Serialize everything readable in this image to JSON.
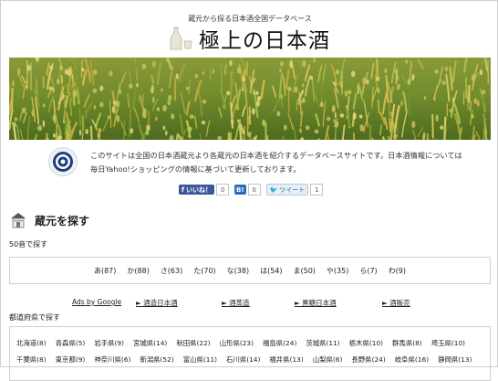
{
  "header": {
    "tagline": "蔵元から探る日本酒全国データベース",
    "title": "極上の日本酒"
  },
  "intro": {
    "line1": "このサイトは全国の日本酒蔵元より各蔵元の日本酒を紹介するデータベースサイトです。日本酒情報については",
    "line2": "毎日Yahoo!ショッピングの情報に基づいて更新しております。"
  },
  "social": {
    "like_label": "いいね！",
    "like_count": "0",
    "hatena_label": "B!",
    "hatena_count": "0",
    "tweet_label": "ツイート",
    "tweet_count": "1"
  },
  "section": {
    "title": "蔵元を探す",
    "kana_label": "50音で探す",
    "pref_label": "都道府県で探す"
  },
  "kana": [
    "あ(87)",
    "か(88)",
    "さ(63)",
    "た(70)",
    "な(38)",
    "は(54)",
    "ま(50)",
    "や(35)",
    "ら(7)",
    "わ(9)"
  ],
  "ads": {
    "label": "Ads by Google",
    "links": [
      "► 酒造日本酒",
      "► 酒蒸造",
      "► 黒糖日本酒",
      "► 酒販売"
    ]
  },
  "prefectures_row1": [
    "北海道(8)",
    "青森県(5)",
    "岩手県(9)",
    "宮城県(14)",
    "秋田県(22)",
    "山形県(23)",
    "福島県(24)",
    "茨城県(11)",
    "栃木県(10)",
    "群馬県(8)",
    "埼玉県(10)"
  ],
  "prefectures_row2": [
    "千葉県(8)",
    "東京都(9)",
    "神奈川県(6)",
    "新潟県(52)",
    "富山県(11)",
    "石川県(14)",
    "福井県(13)",
    "山梨県(6)",
    "長野県(24)",
    "岐阜県(16)",
    "静岡県(13)"
  ],
  "colors": {
    "accent": "#1f3f7a",
    "facebook": "#3b5998",
    "hatena": "#2c6ebd"
  }
}
